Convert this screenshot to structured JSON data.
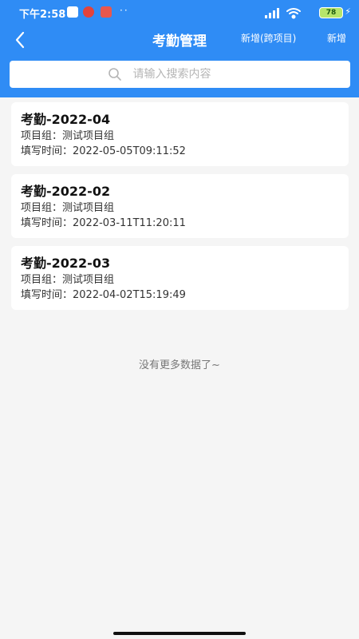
{
  "status_bar": {
    "time": "下午2:58",
    "dots": "··",
    "battery": "78"
  },
  "nav": {
    "title": "考勤管理",
    "add_cross_project": "新增(跨项目)",
    "add": "新增"
  },
  "search": {
    "placeholder": "请输入搜索内容"
  },
  "records": [
    {
      "title": "考勤-2022-04",
      "group_label": "项目组：",
      "group": "测试项目组",
      "time_label": "填写时间：",
      "time": "2022-05-05T09:11:52"
    },
    {
      "title": "考勤-2022-02",
      "group_label": "项目组：",
      "group": "测试项目组",
      "time_label": "填写时间：",
      "time": "2022-03-11T11:20:11"
    },
    {
      "title": "考勤-2022-03",
      "group_label": "项目组：",
      "group": "测试项目组",
      "time_label": "填写时间：",
      "time": "2022-04-02T15:19:49"
    }
  ],
  "footer": {
    "no_more": "没有更多数据了~"
  },
  "colors": {
    "primary": "#2f8cf5",
    "background": "#f5f5f5"
  }
}
